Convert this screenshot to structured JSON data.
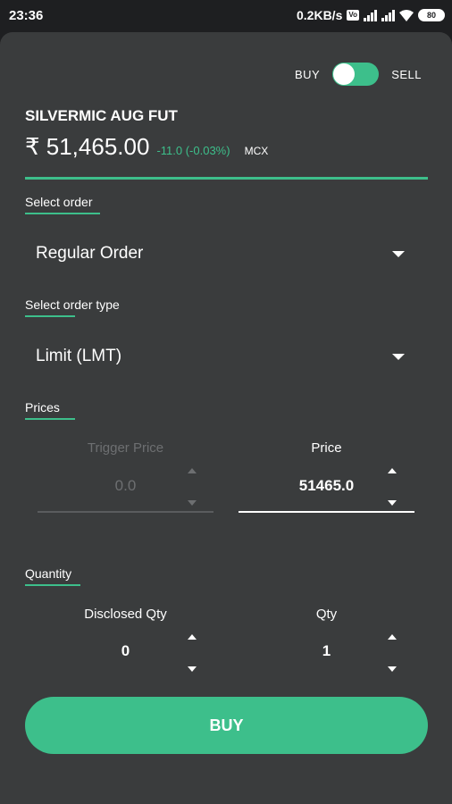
{
  "status_bar": {
    "time": "23:36",
    "net_speed": "0.2KB/s",
    "volte": "Vo",
    "battery": "80"
  },
  "toggle": {
    "left_label": "BUY",
    "right_label": "SELL",
    "state": "BUY"
  },
  "instrument": {
    "name": "SILVERMIC AUG FUT",
    "ltp": "₹ 51,465.00",
    "change": "-11.0 (-0.03%)",
    "exchange": "MCX"
  },
  "order": {
    "label": "Select order",
    "value": "Regular Order"
  },
  "order_type": {
    "label": "Select order type",
    "value": "Limit (LMT)"
  },
  "prices": {
    "label": "Prices",
    "trigger": {
      "title": "Trigger Price",
      "value": "0.0",
      "enabled": false
    },
    "price": {
      "title": "Price",
      "value": "51465.0",
      "enabled": true
    }
  },
  "quantity": {
    "label": "Quantity",
    "disclosed": {
      "title": "Disclosed Qty",
      "value": "0"
    },
    "qty": {
      "title": "Qty",
      "value": "1"
    }
  },
  "action": {
    "label": "BUY"
  },
  "colors": {
    "accent": "#3dbf8b",
    "sheet": "#3a3c3d",
    "background": "#1e1f21",
    "disabled": "#6d6f71"
  }
}
